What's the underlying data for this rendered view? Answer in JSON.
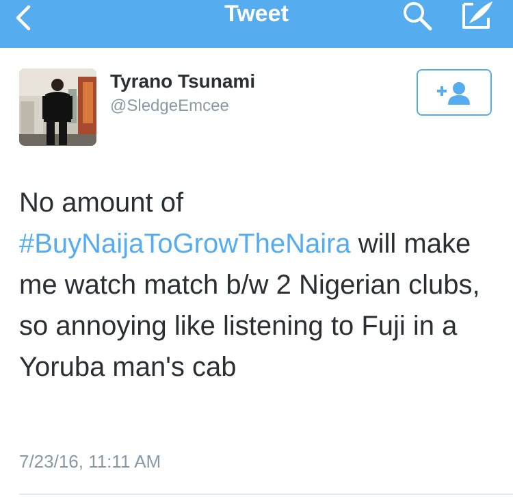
{
  "header": {
    "title": "Tweet",
    "back_icon": "chevron-left-icon",
    "search_icon": "search-icon",
    "compose_icon": "compose-icon",
    "background_color": "#55acee"
  },
  "author": {
    "display_name": "Tyrano Tsunami",
    "handle": "@SledgeEmcee",
    "follow_icon": "add-user-icon"
  },
  "tweet": {
    "text_before": "No amount of ",
    "hashtag": "#BuyNaijaToGrowTheNaira",
    "text_after": " will make me watch match b/w 2 Nigerian clubs, so annoying like listening to Fuji in a Yoruba man's cab",
    "timestamp": "7/23/16, 11:11 AM"
  },
  "colors": {
    "accent": "#55acee",
    "text": "#292f33",
    "secondary_text": "#8899a6"
  }
}
